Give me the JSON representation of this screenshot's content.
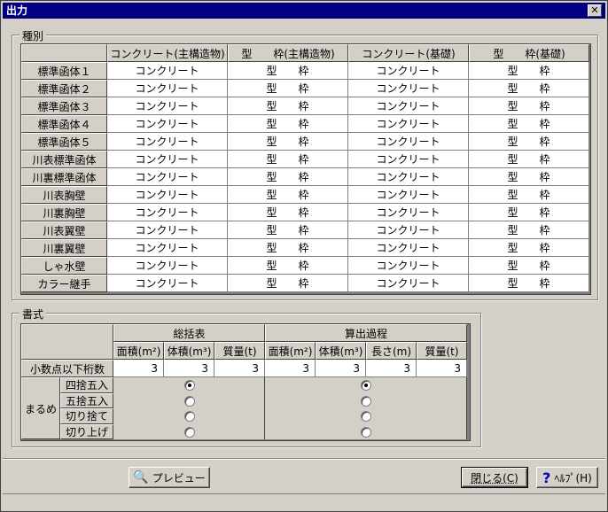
{
  "window": {
    "title": "出力",
    "close_glyph": "✕"
  },
  "kind": {
    "label": "種別",
    "columns": [
      "",
      "コンクリート(主構造物)",
      "型　　枠(主構造物)",
      "コンクリート(基礎)",
      "型　　枠(基礎)"
    ],
    "rows": [
      {
        "name": "標準函体１",
        "c1": "コンクリート",
        "c2": "型　　枠",
        "c3": "コンクリート",
        "c4": "型　　枠"
      },
      {
        "name": "標準函体２",
        "c1": "コンクリート",
        "c2": "型　　枠",
        "c3": "コンクリート",
        "c4": "型　　枠"
      },
      {
        "name": "標準函体３",
        "c1": "コンクリート",
        "c2": "型　　枠",
        "c3": "コンクリート",
        "c4": "型　　枠"
      },
      {
        "name": "標準函体４",
        "c1": "コンクリート",
        "c2": "型　　枠",
        "c3": "コンクリート",
        "c4": "型　　枠"
      },
      {
        "name": "標準函体５",
        "c1": "コンクリート",
        "c2": "型　　枠",
        "c3": "コンクリート",
        "c4": "型　　枠"
      },
      {
        "name": "川表標準函体",
        "c1": "コンクリート",
        "c2": "型　　枠",
        "c3": "コンクリート",
        "c4": "型　　枠"
      },
      {
        "name": "川裏標準函体",
        "c1": "コンクリート",
        "c2": "型　　枠",
        "c3": "コンクリート",
        "c4": "型　　枠"
      },
      {
        "name": "川表胸壁",
        "c1": "コンクリート",
        "c2": "型　　枠",
        "c3": "コンクリート",
        "c4": "型　　枠"
      },
      {
        "name": "川裏胸壁",
        "c1": "コンクリート",
        "c2": "型　　枠",
        "c3": "コンクリート",
        "c4": "型　　枠"
      },
      {
        "name": "川表翼壁",
        "c1": "コンクリート",
        "c2": "型　　枠",
        "c3": "コンクリート",
        "c4": "型　　枠"
      },
      {
        "name": "川裏翼壁",
        "c1": "コンクリート",
        "c2": "型　　枠",
        "c3": "コンクリート",
        "c4": "型　　枠"
      },
      {
        "name": "しゃ水壁",
        "c1": "コンクリート",
        "c2": "型　　枠",
        "c3": "コンクリート",
        "c4": "型　　枠"
      },
      {
        "name": "カラー継手",
        "c1": "コンクリート",
        "c2": "型　　枠",
        "c3": "コンクリート",
        "c4": "型　　枠"
      }
    ]
  },
  "format": {
    "label": "書式",
    "group_summary": "総括表",
    "group_calc": "算出過程",
    "sub_headers": [
      "面積(m²)",
      "体積(m³)",
      "質量(t)",
      "面積(m²)",
      "体積(m³)",
      "長さ(m)",
      "質量(t)"
    ],
    "decimal_label": "小数点以下桁数",
    "decimal_values": [
      "3",
      "3",
      "3",
      "3",
      "3",
      "3",
      "3"
    ],
    "rounding_label": "まるめ",
    "rounding_options": [
      "四捨五入",
      "五捨五入",
      "切り捨て",
      "切り上げ"
    ],
    "summary_selected": 0,
    "calc_selected": 0
  },
  "buttons": {
    "preview": "プレビュー",
    "close": "閉じる(C)",
    "help": "ﾍﾙﾌﾟ(H)"
  }
}
